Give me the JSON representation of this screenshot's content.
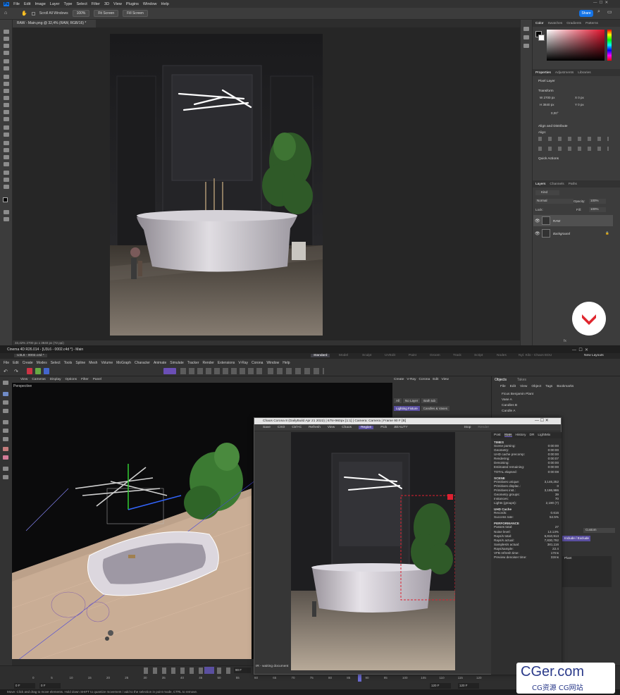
{
  "photoshop": {
    "menu": [
      "File",
      "Edit",
      "Image",
      "Layer",
      "Type",
      "Select",
      "Filter",
      "3D",
      "View",
      "Plugins",
      "Window",
      "Help"
    ],
    "options": {
      "scroll_all": "Scroll All Windows",
      "zoom": "100%",
      "fit_screen": "Fit Screen",
      "fill_screen": "Fill Screen",
      "share": "Share"
    },
    "doc_tab": "RAW - Main.png @ 32,4% (RAW, RGB/16) *",
    "status": "33,42%    2700 px x 3840 px (72 ppi)",
    "panels": {
      "color_tabs": [
        "Color",
        "Swatches",
        "Gradients",
        "Patterns"
      ],
      "props_tabs": [
        "Properties",
        "Adjustments",
        "Libraries"
      ],
      "pixel_layer": "Pixel Layer",
      "transform": "Transform",
      "w": "W  2700 px",
      "h": "H  3840 px",
      "x": "X  0 px",
      "y": "Y  0 px",
      "angle": "0,00°",
      "align": "Align and Distribute",
      "align_label": "Align:",
      "quick": "Quick Actions",
      "layers_tabs": [
        "Layers",
        "Channels",
        "Paths"
      ],
      "kind": "Kind",
      "blend": "Normal",
      "opacity": "Opacity:",
      "opacity_val": "100%",
      "lock": "Lock:",
      "fill": "Fill:",
      "fill_val": "100%",
      "layers": [
        {
          "name": "RAW"
        },
        {
          "name": "Background"
        }
      ],
      "footer": "fx"
    }
  },
  "c4d": {
    "title": "Cinema 4D R26.014 - [U3L6 - 0002.c4d *] - Main",
    "tab": "U3L6 - 0002.c4d *",
    "layouts": [
      "Standard",
      "Model",
      "Sculpt",
      "UVEdit",
      "Paint",
      "Groom",
      "Track",
      "Script",
      "Nodes",
      "Nyl. Kilo - Chaos EDU"
    ],
    "new_layouts": "New Layouts",
    "menu": [
      "File",
      "Edit",
      "Create",
      "Modes",
      "Select",
      "Tools",
      "Spline",
      "Mesh",
      "Volume",
      "MoGraph",
      "Character",
      "Animate",
      "Simulate",
      "Tracker",
      "Render",
      "Extensions",
      "V-Ray",
      "Corona",
      "Window",
      "Help"
    ],
    "vp_menu": [
      "View",
      "Cameras",
      "Display",
      "Options",
      "Filter",
      "Panel"
    ],
    "vp_label": "Perspective",
    "rtools_menu": [
      "Create",
      "V-Ray",
      "Corona",
      "Edit",
      "View"
    ],
    "light_tabs": [
      "All",
      "No Layer",
      "Bath tub",
      "Lighting Fixture",
      "Candles & Vases"
    ],
    "objects_tab": "Objects",
    "takes_tab": "Takes",
    "obj_menu": [
      "File",
      "Edit",
      "View",
      "Object",
      "Tags",
      "Bookmarks"
    ],
    "objects": [
      "Ficus Benjamin Plant",
      "Vase A",
      "Candles B",
      "Candle A"
    ],
    "include": "Include / Exclude",
    "custom": "Custom",
    "plant_label": "Plant",
    "timeline_ticks": [
      "0",
      "5",
      "10",
      "15",
      "20",
      "25",
      "30",
      "35",
      "40",
      "45",
      "50",
      "55",
      "60",
      "65",
      "70",
      "75",
      "80",
      "85",
      "90",
      "95",
      "100",
      "105",
      "110",
      "115",
      "120"
    ],
    "frame_start": "0 F",
    "frame_end": "120 F",
    "frame_cur": "90 F",
    "status": "Move: Click and drag to move elements. Hold down SHIFT to quantize movement / add to the selection in point mode, CTRL to remove."
  },
  "corona": {
    "title": "Chaos Corona 8 (DailyBuild Apr 21 2022) | 675×960px [1:1] | Camera: Camera | Frame 90 F [B]",
    "toolbar": [
      "Save",
      "CXO",
      "Ctrl+C",
      "Refresh",
      "View",
      "Chaos",
      "Region",
      "Pick",
      "BEAUTY"
    ],
    "stop": "Stop",
    "render": "Render",
    "tabs": [
      "Post",
      "Stats",
      "History",
      "DR",
      "LightMix"
    ],
    "status": "IR - waiting document",
    "sections": [
      {
        "head": "TIMES",
        "rows": [
          [
            "Scene parsing:",
            "0:00:00"
          ],
          [
            "Geometry:",
            "0:00:00"
          ],
          [
            "UHD cache precomp:",
            "0:00:00"
          ],
          [
            "Rendering:",
            "0:00:07"
          ],
          [
            "Denoising:",
            "0:00:00"
          ],
          [
            "Estimated remaining:",
            "0:00:00"
          ],
          [
            "TOTAL elapsed:",
            "0:00:08"
          ]
        ]
      },
      {
        "head": "SCENE",
        "rows": [
          [
            "Primitives unique:",
            "3,146,252"
          ],
          [
            "Primitives displac.:",
            "0"
          ],
          [
            "Primitives inst.:",
            "3,186,986"
          ],
          [
            "Geometry groups:",
            "39"
          ],
          [
            "Instances:",
            "70"
          ],
          [
            "Lights (groups):",
            "2,190 (7)"
          ]
        ]
      },
      {
        "head": "UHD Cache",
        "rows": [
          [
            "Records:",
            "0.616"
          ],
          [
            "Success rate:",
            "54.5%"
          ]
        ]
      },
      {
        "head": "PERFORMANCE",
        "rows": [
          [
            "Passes total:",
            "27"
          ],
          [
            "Noise level:",
            "13.13%"
          ],
          [
            "Rays/s total:",
            "6,810,913"
          ],
          [
            "Rays/s actual:",
            "7,830,792"
          ],
          [
            "Samples/s actual:",
            "381,116"
          ],
          [
            "Rays/sample:",
            "22.4"
          ],
          [
            "VFB refresh time:",
            "17ms"
          ],
          [
            "Preview denoiser time:",
            "32ms"
          ]
        ]
      }
    ]
  },
  "watermark": {
    "brand": "CGer.com",
    "sub": "CG资源  CG网站"
  }
}
